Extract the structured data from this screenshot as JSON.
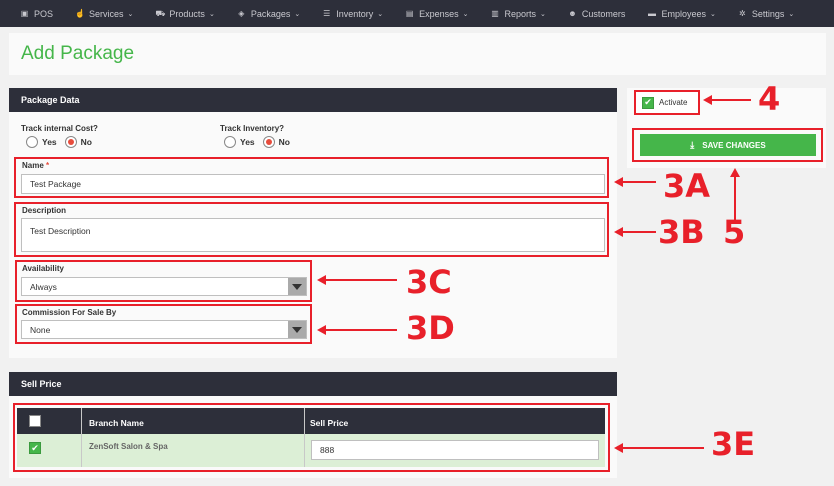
{
  "nav": {
    "items": [
      {
        "label": "POS",
        "icon": "pos-icon"
      },
      {
        "label": "Services",
        "icon": "hand-icon",
        "caret": true
      },
      {
        "label": "Products",
        "icon": "cart-icon",
        "caret": true
      },
      {
        "label": "Packages",
        "icon": "tag-icon",
        "caret": true
      },
      {
        "label": "Inventory",
        "icon": "list-icon",
        "caret": true
      },
      {
        "label": "Expenses",
        "icon": "money-icon",
        "caret": true
      },
      {
        "label": "Reports",
        "icon": "bar-chart-icon",
        "caret": true
      },
      {
        "label": "Customers",
        "icon": "users-icon"
      },
      {
        "label": "Employees",
        "icon": "briefcase-icon",
        "caret": true
      },
      {
        "label": "Settings",
        "icon": "gear-icon",
        "caret": true
      }
    ]
  },
  "page": {
    "title": "Add Package"
  },
  "package_data": {
    "header": "Package Data",
    "track_cost_label": "Track internal Cost?",
    "track_inventory_label": "Track Inventory?",
    "yes_label": "Yes",
    "no_label": "No",
    "track_cost_selected": "No",
    "track_inventory_selected": "No",
    "name_label": "Name",
    "required_mark": "*",
    "name_value": "Test Package",
    "description_label": "Description",
    "description_value": "Test Description",
    "availability_label": "Availability",
    "availability_value": "Always",
    "commission_label": "Commission For Sale By",
    "commission_value": "None"
  },
  "sidebar": {
    "activate_label": "Activate",
    "activate_checked": true,
    "save_label": "SAVE CHANGES"
  },
  "sell_price": {
    "header": "Sell Price",
    "columns": [
      "Branch Name",
      "Sell Price"
    ],
    "rows": [
      {
        "checked": true,
        "branch": "ZenSoft Salon & Spa",
        "price": "888"
      }
    ]
  },
  "callouts": {
    "c4": "4",
    "c5": "5",
    "c3a": "3A",
    "c3b": "3B",
    "c3c": "3C",
    "c3d": "3D",
    "c3e": "3E"
  },
  "colors": {
    "accent": "#45b64a",
    "nav_bg": "#2d2f3a",
    "annotation": "#e8202a",
    "radio_on": "#e74c3c"
  }
}
